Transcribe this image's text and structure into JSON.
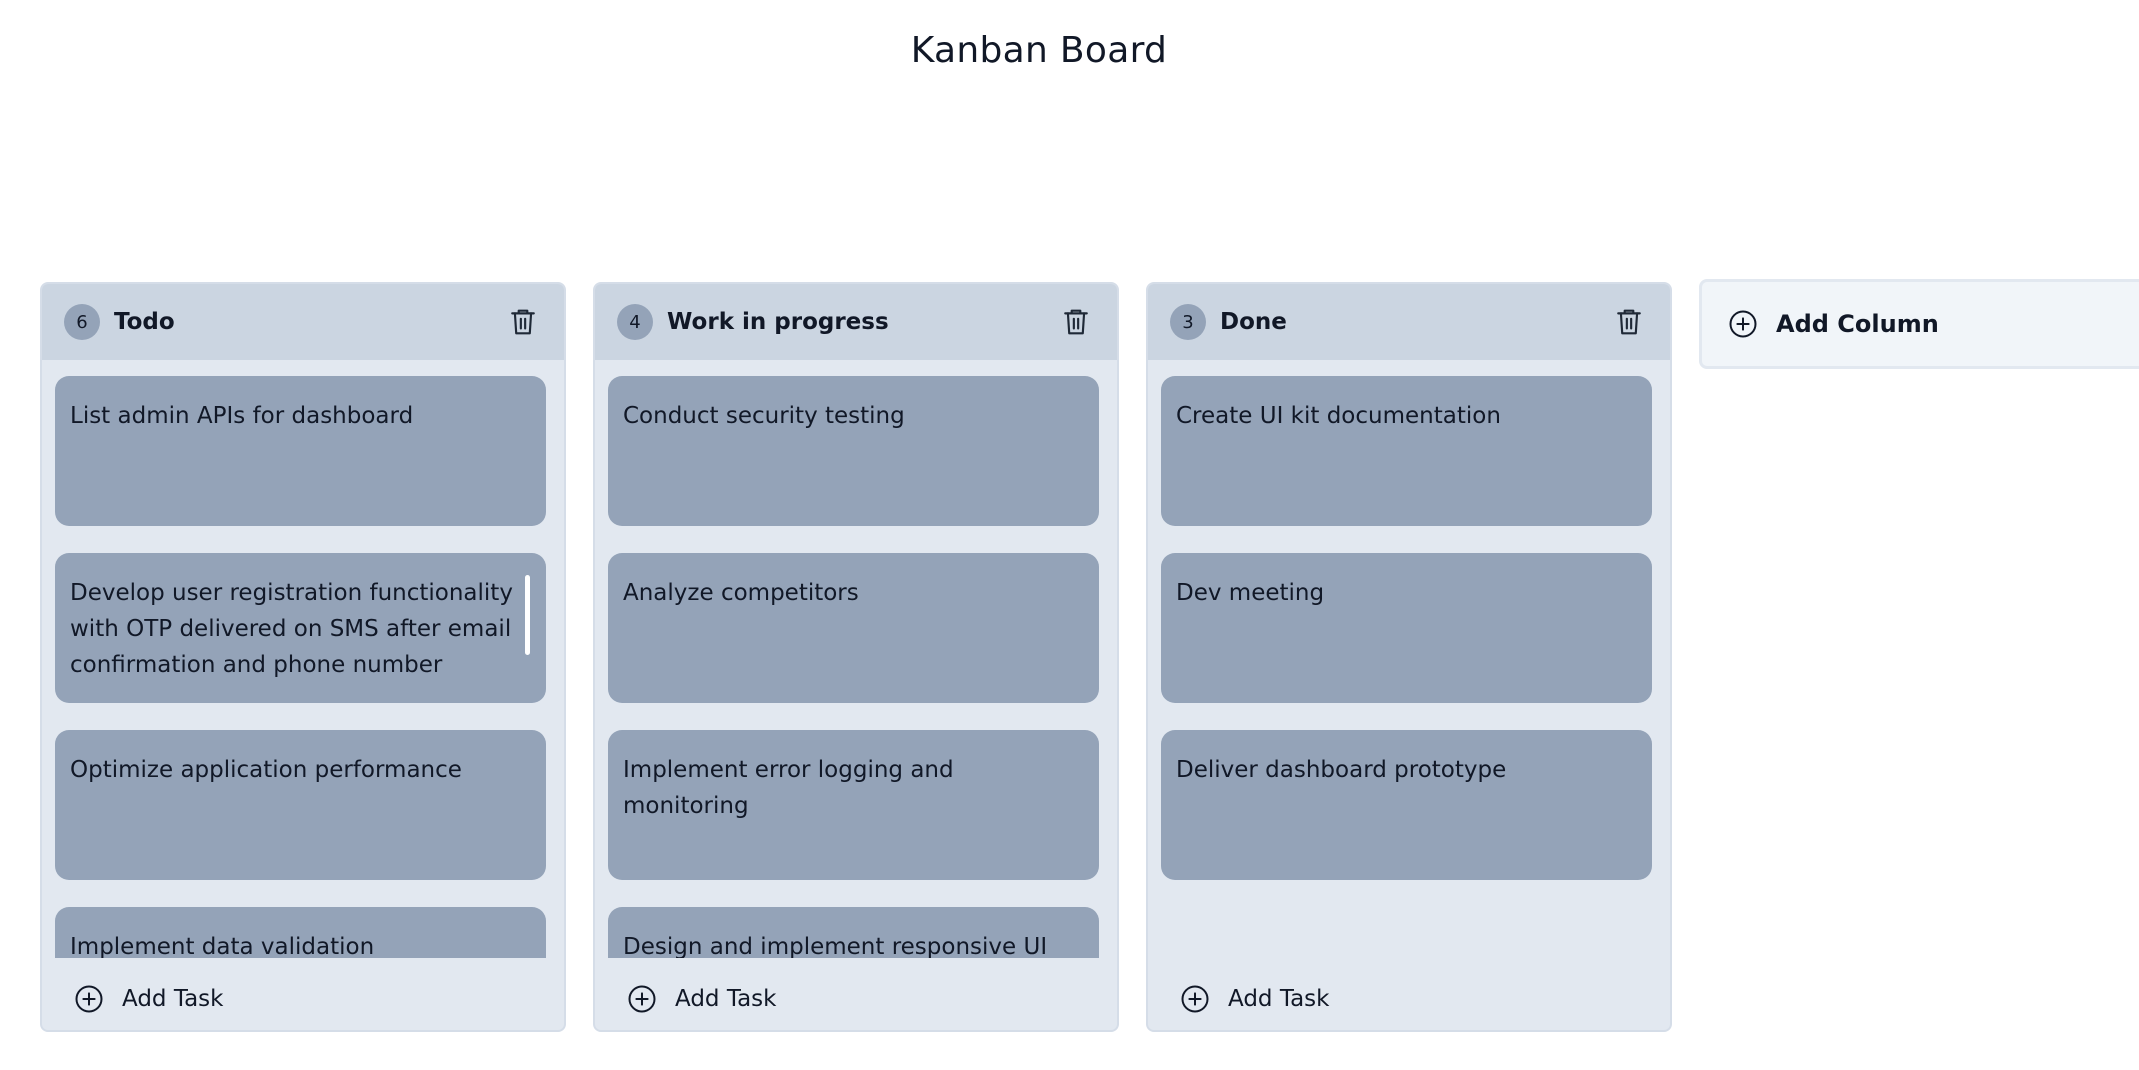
{
  "page_title": "Kanban Board",
  "columns": [
    {
      "count": "6",
      "title": "Todo",
      "tasks": [
        "List admin APIs for dashboard",
        "Develop user registration functionality with OTP delivered on SMS after email confirmation and phone number",
        "Optimize application performance",
        "Implement data validation"
      ],
      "add_task_label": "Add Task"
    },
    {
      "count": "4",
      "title": "Work in progress",
      "tasks": [
        "Conduct security testing",
        "Analyze competitors",
        "Implement error logging and monitoring",
        "Design and implement responsive UI"
      ],
      "add_task_label": "Add Task"
    },
    {
      "count": "3",
      "title": "Done",
      "tasks": [
        "Create UI kit documentation",
        "Dev meeting",
        "Deliver dashboard prototype"
      ],
      "add_task_label": "Add Task"
    }
  ],
  "add_column_label": "Add Column",
  "icons": {
    "delete": "trash-icon",
    "add": "plus-circle-icon"
  },
  "colors": {
    "column_bg": "#e2e8f0",
    "column_header_bg": "#cbd5e1",
    "task_bg": "#94a3b8",
    "badge_bg": "#94a3b8"
  }
}
